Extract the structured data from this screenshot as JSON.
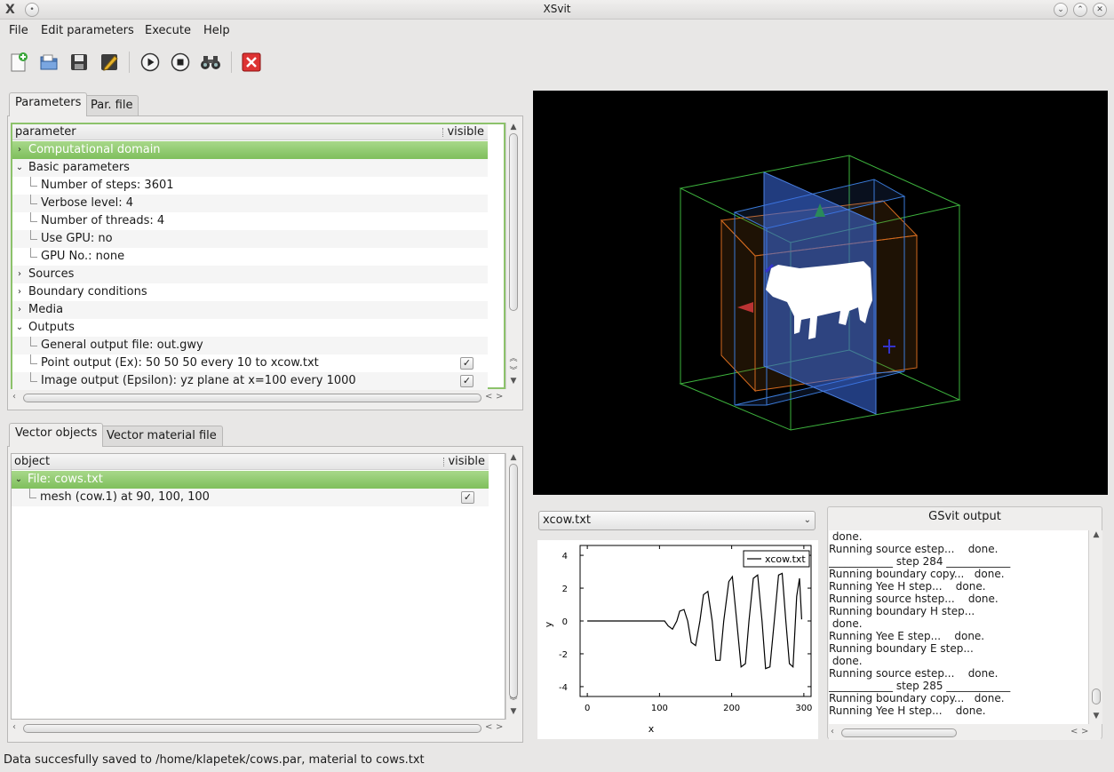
{
  "window": {
    "title": "XSvit",
    "logo": "X",
    "menu_glyph": "•",
    "minimize_glyph": "⌄",
    "maximize_glyph": "⌃",
    "close_glyph": "✕"
  },
  "menubar": {
    "items": [
      "File",
      "Edit parameters",
      "Execute",
      "Help"
    ]
  },
  "toolbar": {
    "icons": [
      "new-file-icon",
      "open-file-icon",
      "save-icon",
      "edit-icon",
      "run-icon",
      "stop-icon",
      "binoculars-icon",
      "close-red-icon"
    ]
  },
  "params_panel": {
    "tabs": [
      "Parameters",
      "Par. file"
    ],
    "active_tab": 0,
    "header": {
      "col1": "parameter",
      "col2": "visible"
    },
    "rows": [
      {
        "label": "Computational domain",
        "expander": "›",
        "level": 0,
        "selected": true
      },
      {
        "label": "Basic parameters",
        "expander": "⌄",
        "level": 0
      },
      {
        "label": "Number of steps: 3601",
        "level": 1
      },
      {
        "label": "Verbose level: 4",
        "level": 1
      },
      {
        "label": "Number of threads: 4",
        "level": 1
      },
      {
        "label": "Use GPU: no",
        "level": 1
      },
      {
        "label": "GPU No.: none",
        "level": 1
      },
      {
        "label": "Sources",
        "expander": "›",
        "level": 0
      },
      {
        "label": "Boundary conditions",
        "expander": "›",
        "level": 0
      },
      {
        "label": "Media",
        "expander": "›",
        "level": 0
      },
      {
        "label": "Outputs",
        "expander": "⌄",
        "level": 0
      },
      {
        "label": "General output file: out.gwy",
        "level": 1
      },
      {
        "label": "Point output (Ex): 50 50 50 every 10 to xcow.txt",
        "level": 1,
        "check": "✓"
      },
      {
        "label": "Image output (Epsilon): yz plane at x=100 every 1000",
        "level": 1,
        "check": "✓"
      }
    ]
  },
  "vector_panel": {
    "tabs": [
      "Vector objects",
      "Vector material file"
    ],
    "active_tab": 0,
    "header": {
      "col1": "object",
      "col2": "visible"
    },
    "rows": [
      {
        "label": "File: cows.txt",
        "expander": "⌄",
        "level": 0,
        "selected": true
      },
      {
        "label": "mesh (cow.1) at 90, 100, 100",
        "level": 1,
        "check": "✓"
      }
    ]
  },
  "scroll_glyphs": {
    "up": "▲",
    "down": "▼",
    "left": "‹",
    "right": "›",
    "nav_left": "<",
    "nav_right": ">",
    "double_up": "︽",
    "double_down": "︾"
  },
  "combo": {
    "value": "xcow.txt",
    "arrow": "⌄"
  },
  "chart_data": {
    "type": "line",
    "xlabel": "x",
    "ylabel": "y",
    "xlim": [
      -10,
      310
    ],
    "ylim": [
      -4.6,
      4.6
    ],
    "xticks": [
      0,
      100,
      200,
      300
    ],
    "yticks": [
      4,
      2,
      0,
      -2,
      -4
    ],
    "legend": "top-right",
    "series": [
      {
        "name": "xcow.txt",
        "color": "#000000",
        "x": [
          0,
          50,
          100,
          107,
          112,
          118,
          124,
          128,
          134,
          139,
          144,
          150,
          156,
          161,
          167,
          173,
          178,
          184,
          189,
          196,
          201,
          207,
          213,
          219,
          224,
          230,
          236,
          242,
          247,
          253,
          259,
          265,
          270,
          275,
          280,
          285,
          290,
          294,
          297
        ],
        "y": [
          0,
          0,
          0,
          0,
          -0.3,
          -0.5,
          0,
          0.6,
          0.7,
          0,
          -1.3,
          -1.5,
          0,
          1.6,
          1.8,
          0,
          -2.4,
          -2.4,
          0,
          2.4,
          2.7,
          0,
          -2.8,
          -2.6,
          0,
          2.6,
          2.8,
          0,
          -2.9,
          -2.8,
          0,
          2.8,
          2.9,
          0,
          -2.6,
          -2.8,
          1.5,
          2.6,
          0.1
        ]
      }
    ]
  },
  "output_panel": {
    "title": "GSvit output",
    "lines": [
      " done.",
      "Running source estep...    done.",
      "____________ step 284 ____________",
      "Running boundary copy...   done.",
      "Running Yee H step...    done.",
      "Running source hstep...    done.",
      "Running boundary H step...",
      " done.",
      "Running Yee E step...    done.",
      "Running boundary E step...",
      " done.",
      "Running source estep...    done.",
      "____________ step 285 ____________",
      "Running boundary copy...   done.",
      "Running Yee H step...    done."
    ]
  },
  "status": "Data succesfully saved to /home/klapetek/cows.par, material to cows.txt"
}
